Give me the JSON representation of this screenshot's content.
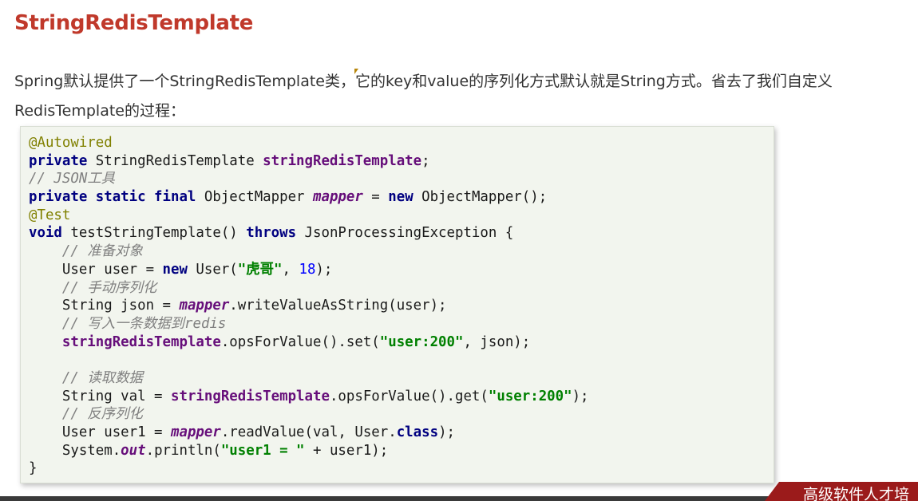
{
  "title": "StringRedisTemplate",
  "description": "Spring默认提供了一个StringRedisTemplate类，它的key和value的序列化方式默认就是String方式。省去了我们自定义RedisTemplate的过程：",
  "code_lines": [
    [
      {
        "t": "@Autowired",
        "c": "ann"
      }
    ],
    [
      {
        "t": "private",
        "c": "kw"
      },
      {
        "t": " StringRedisTemplate ",
        "c": ""
      },
      {
        "t": "stringRedisTemplate",
        "c": "fld"
      },
      {
        "t": ";",
        "c": ""
      }
    ],
    [
      {
        "t": "// JSON工具",
        "c": "cmt"
      }
    ],
    [
      {
        "t": "private static final",
        "c": "kw"
      },
      {
        "t": " ObjectMapper ",
        "c": ""
      },
      {
        "t": "mapper",
        "c": "sfld"
      },
      {
        "t": " = ",
        "c": ""
      },
      {
        "t": "new",
        "c": "kw"
      },
      {
        "t": " ObjectMapper();",
        "c": ""
      }
    ],
    [
      {
        "t": "@Test",
        "c": "ann"
      }
    ],
    [
      {
        "t": "void",
        "c": "kw"
      },
      {
        "t": " testStringTemplate() ",
        "c": ""
      },
      {
        "t": "throws",
        "c": "kw"
      },
      {
        "t": " JsonProcessingException {",
        "c": ""
      }
    ],
    [
      {
        "t": "    ",
        "c": ""
      },
      {
        "t": "// 准备对象",
        "c": "cmt"
      }
    ],
    [
      {
        "t": "    User user = ",
        "c": ""
      },
      {
        "t": "new",
        "c": "kw"
      },
      {
        "t": " User(",
        "c": ""
      },
      {
        "t": "\"虎哥\"",
        "c": "str"
      },
      {
        "t": ", ",
        "c": ""
      },
      {
        "t": "18",
        "c": "num"
      },
      {
        "t": ");",
        "c": ""
      }
    ],
    [
      {
        "t": "    ",
        "c": ""
      },
      {
        "t": "// 手动序列化",
        "c": "cmt"
      }
    ],
    [
      {
        "t": "    String json = ",
        "c": ""
      },
      {
        "t": "mapper",
        "c": "sfld"
      },
      {
        "t": ".writeValueAsString(user);",
        "c": ""
      }
    ],
    [
      {
        "t": "    ",
        "c": ""
      },
      {
        "t": "// 写入一条数据到redis",
        "c": "cmt"
      }
    ],
    [
      {
        "t": "    ",
        "c": ""
      },
      {
        "t": "stringRedisTemplate",
        "c": "fld"
      },
      {
        "t": ".opsForValue().set(",
        "c": ""
      },
      {
        "t": "\"user:200\"",
        "c": "str"
      },
      {
        "t": ", json);",
        "c": ""
      }
    ],
    [
      {
        "t": "",
        "c": ""
      }
    ],
    [
      {
        "t": "    ",
        "c": ""
      },
      {
        "t": "// 读取数据",
        "c": "cmt"
      }
    ],
    [
      {
        "t": "    String val = ",
        "c": ""
      },
      {
        "t": "stringRedisTemplate",
        "c": "fld"
      },
      {
        "t": ".opsForValue().get(",
        "c": ""
      },
      {
        "t": "\"user:200\"",
        "c": "str"
      },
      {
        "t": ");",
        "c": ""
      }
    ],
    [
      {
        "t": "    ",
        "c": ""
      },
      {
        "t": "// 反序列化",
        "c": "cmt"
      }
    ],
    [
      {
        "t": "    User user1 = ",
        "c": ""
      },
      {
        "t": "mapper",
        "c": "sfld"
      },
      {
        "t": ".readValue(val, User.",
        "c": ""
      },
      {
        "t": "class",
        "c": "kw"
      },
      {
        "t": ");",
        "c": ""
      }
    ],
    [
      {
        "t": "    System.",
        "c": ""
      },
      {
        "t": "out",
        "c": "sfld"
      },
      {
        "t": ".println(",
        "c": ""
      },
      {
        "t": "\"user1 = \"",
        "c": "str"
      },
      {
        "t": " + user1);",
        "c": ""
      }
    ],
    [
      {
        "t": "}",
        "c": ""
      }
    ]
  ],
  "footer": {
    "banner_text": "高级软件人才培"
  }
}
